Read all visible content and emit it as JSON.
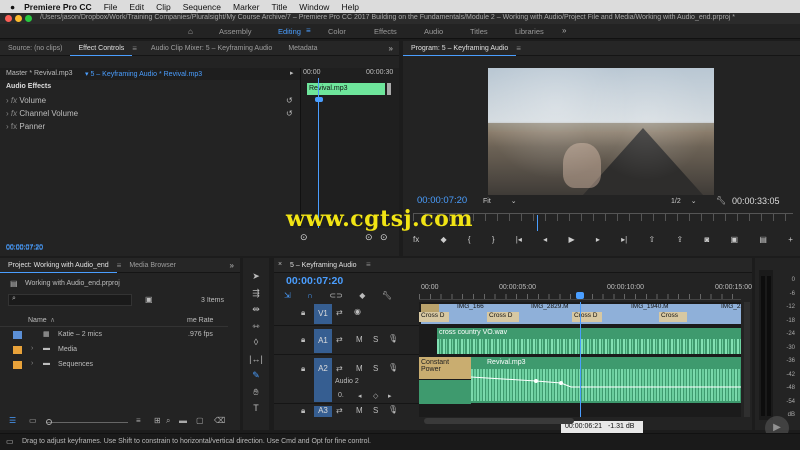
{
  "menubar": {
    "app": "Premiere Pro CC",
    "items": [
      "File",
      "Edit",
      "Clip",
      "Sequence",
      "Marker",
      "Title",
      "Window",
      "Help"
    ]
  },
  "title": "/Users/jason/Dropbox/Work/Training Companies/Pluralsight/My Course Archive/7 – Premiere Pro CC 2017 Building on the Fundamentals/Module 2 – Working with Audio/Project File and Media/Working with Audio_end.prproj *",
  "workspaces": [
    "Assembly",
    "Editing",
    "Color",
    "Effects",
    "Audio",
    "Titles",
    "Libraries"
  ],
  "source": {
    "tabs": [
      "Source: (no clips)",
      "Effect Controls",
      "Audio Clip Mixer: 5 – Keyframing Audio",
      "Metadata"
    ],
    "master": "Master * Revival.mp3",
    "clip": "5 – Keyframing Audio * Revival.mp3",
    "tc_start": "00:00",
    "tc_end": "00:00:30",
    "section": "Audio Effects",
    "effects": [
      "Volume",
      "Channel Volume",
      "Panner"
    ],
    "clip_label": "Revival.mp3",
    "timecode": "00:00:07:20"
  },
  "program": {
    "title": "Program: 5 – Keyframing Audio",
    "timecode": "00:00:07:20",
    "fit": "Fit",
    "ratio": "1/2",
    "duration": "00:00:33:05"
  },
  "watermark": "www.cgtsj.com",
  "project": {
    "tabs": [
      "Project: Working with Audio_end",
      "Media Browser"
    ],
    "file": "Working with Audio_end.prproj",
    "items_count": "3 Items",
    "col_name": "Name",
    "col_rate": "me Rate",
    "rows": [
      {
        "name": "Katie – 2 mics",
        "rate": ".976 fps",
        "color": "#5b8fd6"
      },
      {
        "name": "Media",
        "rate": "",
        "color": "#e8a23a"
      },
      {
        "name": "Sequences",
        "rate": "",
        "color": "#e8a23a"
      }
    ]
  },
  "timeline": {
    "tab": "5 – Keyframing Audio",
    "timecode": "00:00:07:20",
    "ruler": [
      "00:00",
      "00:00:05:00",
      "00:00:10:00",
      "00:00:15:00"
    ],
    "tracks": [
      "V1",
      "A1",
      "A2",
      "A3"
    ],
    "a2_name": "Audio 2",
    "video_clips": [
      "IMG_166",
      "IMG_2829.M",
      "IMG_1940.M",
      "IMG_2221"
    ],
    "transitions": [
      "Cross D",
      "Cross D",
      "Cross D",
      "Cross"
    ],
    "a1_clip": "cross country VO.wav",
    "a2_clip": "Revival.mp3",
    "a2_left": "Constant Power",
    "tooltip_tc": "00:00:06:21",
    "tooltip_db": "-1.31 dB"
  },
  "meter": [
    "0",
    "-6",
    "-12",
    "-18",
    "-24",
    "-30",
    "-36",
    "-42",
    "-48",
    "-54",
    "dB"
  ],
  "status": "Drag to adjust keyframes. Use Shift to constrain to horizontal/vertical direction. Use Cmd and Opt for fine control."
}
